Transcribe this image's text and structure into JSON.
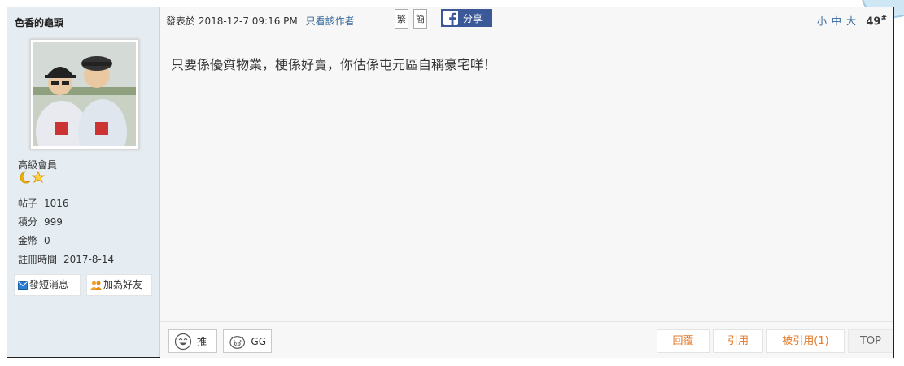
{
  "author": {
    "name": "色香的龜頭",
    "rank": "高級會員",
    "stats": [
      {
        "label": "帖子",
        "value": "1016"
      },
      {
        "label": "積分",
        "value": "999"
      },
      {
        "label": "金幣",
        "value": "0"
      },
      {
        "label": "註冊時間",
        "value": "2017-8-14"
      }
    ],
    "pm_label": "發短消息",
    "add_friend_label": "加為好友"
  },
  "post": {
    "posted_prefix": "發表於",
    "posted_time": "2018-12-7 09:16 PM",
    "author_only": "只看該作者",
    "trad_label": "繁",
    "simp_label": "簡",
    "share_label": "分享",
    "font_size_controls": "小中大",
    "floor_number": "49",
    "floor_suffix": "#",
    "content": "只要係優質物業，梗係好賣，你估係屯元區自稱豪宅咩！"
  },
  "footer": {
    "push_label": "推",
    "gg_label": "GG",
    "reply_label": "回覆",
    "quote_label": "引用",
    "quoted_label": "被引用(1)",
    "top_label": "TOP"
  },
  "colors": {
    "sidebar_bg": "#e5edf2",
    "link": "#336699",
    "action_orange": "#e57928",
    "facebook_blue": "#3b5998"
  }
}
